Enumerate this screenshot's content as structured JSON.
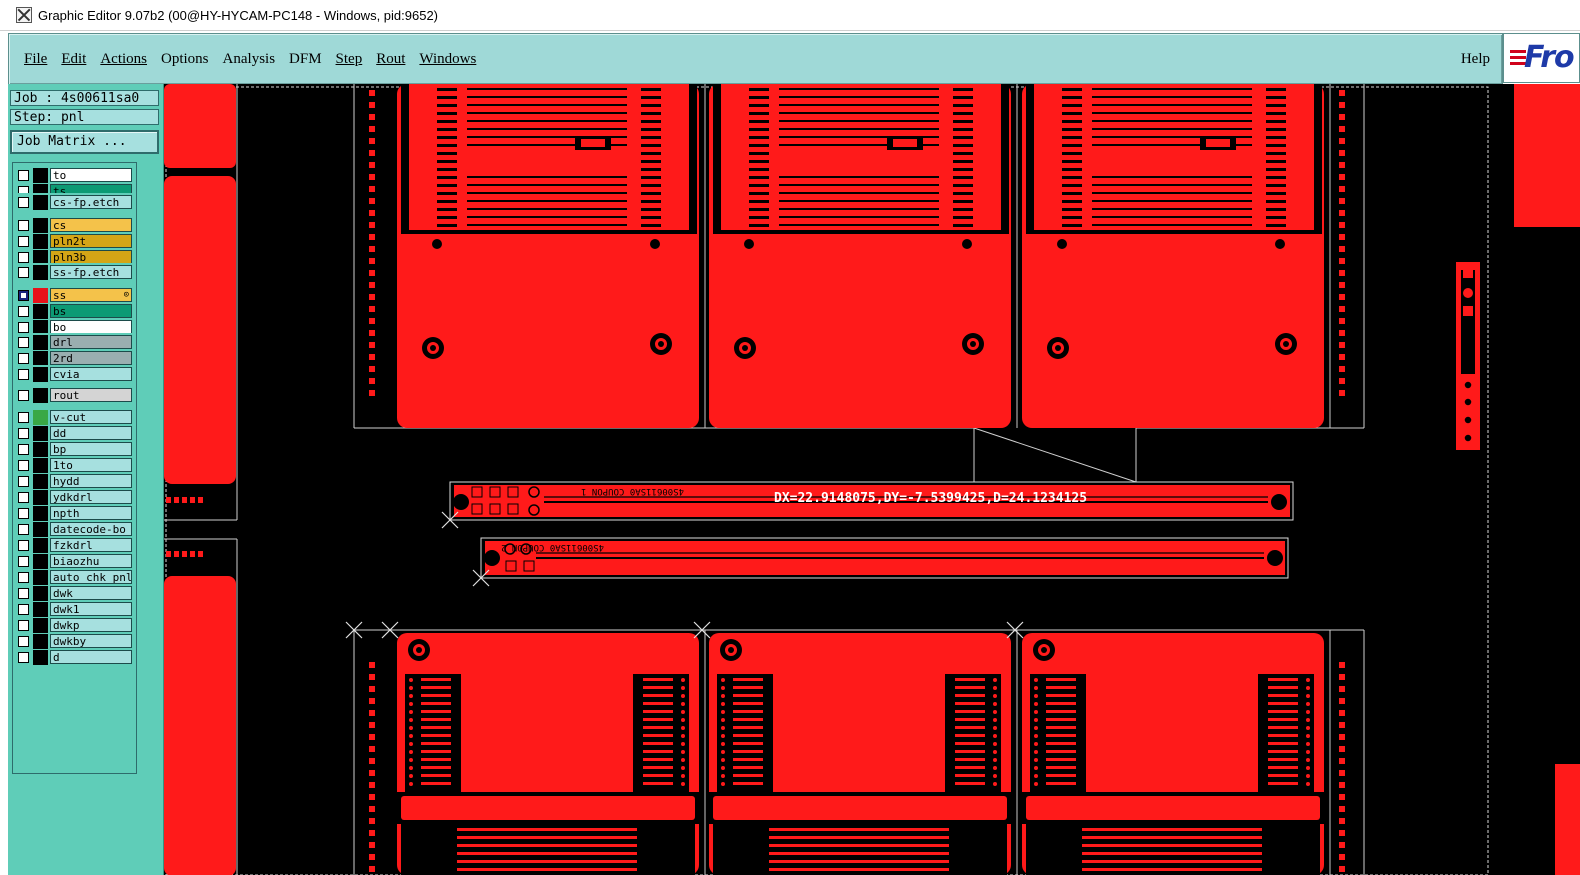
{
  "window": {
    "title": "Graphic Editor 9.07b2 (00@HY-HYCAM-PC148 - Windows, pid:9652)"
  },
  "menu": {
    "items": [
      "File",
      "Edit",
      "Actions",
      "Options",
      "Analysis",
      "DFM",
      "Step",
      "Rout",
      "Windows"
    ],
    "help": "Help"
  },
  "brand": {
    "text": "Fro"
  },
  "job": {
    "label": "Job : 4s00611sa0",
    "step": "Step: pnl",
    "matrix_button": "Job Matrix ..."
  },
  "layers": [
    {
      "name": "to",
      "bg": "#ffffff",
      "swatch": "#000000",
      "checked": false
    },
    {
      "name": "ts",
      "bg": "#0c9a74",
      "swatch": "#000000",
      "checked": false
    },
    {
      "name": "cs-fp.etch",
      "bg": "#a6e0df",
      "swatch": "#000000",
      "checked": false
    },
    {
      "name": "cs",
      "bg": "#f4c24a",
      "swatch": "#000000",
      "checked": false
    },
    {
      "name": "pln2t",
      "bg": "#d4a516",
      "swatch": "#000000",
      "checked": false
    },
    {
      "name": "pln3b",
      "bg": "#d4a516",
      "swatch": "#000000",
      "checked": false
    },
    {
      "name": "ss-fp.etch",
      "bg": "#a6e0df",
      "swatch": "#000000",
      "checked": false
    },
    {
      "name": "ss",
      "bg": "#f4c24a",
      "swatch": "#e8121a",
      "checked": true
    },
    {
      "name": "bs",
      "bg": "#0c9a74",
      "swatch": "#000000",
      "checked": false
    },
    {
      "name": "bo",
      "bg": "#ffffff",
      "swatch": "#000000",
      "checked": false
    },
    {
      "name": "drl",
      "bg": "#9aaeb0",
      "swatch": "#000000",
      "checked": false
    },
    {
      "name": "2rd",
      "bg": "#9aaeb0",
      "swatch": "#000000",
      "checked": false
    },
    {
      "name": "cvia",
      "bg": "#a6e0df",
      "swatch": "#000000",
      "checked": false
    },
    {
      "name": "rout",
      "bg": "#d4d4d4",
      "swatch": "#000000",
      "checked": false
    },
    {
      "name": "v-cut",
      "bg": "#a6e0df",
      "swatch": "#39a845",
      "checked": false
    },
    {
      "name": "dd",
      "bg": "#a6e0df",
      "swatch": "#000000",
      "checked": false
    },
    {
      "name": "bp",
      "bg": "#a6e0df",
      "swatch": "#000000",
      "checked": false
    },
    {
      "name": "1to",
      "bg": "#a6e0df",
      "swatch": "#000000",
      "checked": false
    },
    {
      "name": "hydd",
      "bg": "#a6e0df",
      "swatch": "#000000",
      "checked": false
    },
    {
      "name": "ydkdrl",
      "bg": "#a6e0df",
      "swatch": "#000000",
      "checked": false
    },
    {
      "name": "npth",
      "bg": "#a6e0df",
      "swatch": "#000000",
      "checked": false
    },
    {
      "name": "datecode-bo",
      "bg": "#a6e0df",
      "swatch": "#000000",
      "checked": false
    },
    {
      "name": "fzkdrl",
      "bg": "#a6e0df",
      "swatch": "#000000",
      "checked": false
    },
    {
      "name": "biaozhu",
      "bg": "#a6e0df",
      "swatch": "#000000",
      "checked": false
    },
    {
      "name": "auto_chk_pnl",
      "bg": "#a6e0df",
      "swatch": "#000000",
      "checked": false
    },
    {
      "name": "dwk",
      "bg": "#a6e0df",
      "swatch": "#000000",
      "checked": false
    },
    {
      "name": "dwk1",
      "bg": "#a6e0df",
      "swatch": "#000000",
      "checked": false
    },
    {
      "name": "dwkp",
      "bg": "#a6e0df",
      "swatch": "#000000",
      "checked": false
    },
    {
      "name": "dwkby",
      "bg": "#a6e0df",
      "swatch": "#000000",
      "checked": false
    },
    {
      "name": "d",
      "bg": "#a6e0df",
      "swatch": "#000000",
      "checked": false
    }
  ],
  "canvas": {
    "measurement": "DX=22.9148075,DY=-7.5399425,D=24.1234125",
    "coupon1_label": "4S00611SA0 COUPON 1",
    "coupon2_label": "4S00611SA0 COUPON 2",
    "copper_color": "#ff1a1a"
  }
}
